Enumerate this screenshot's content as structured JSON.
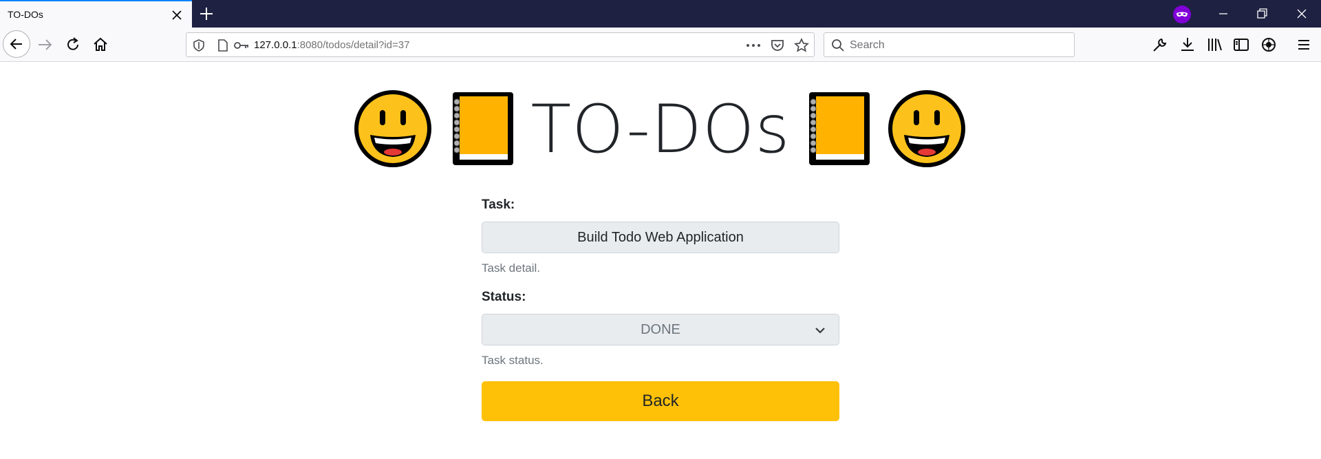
{
  "browser": {
    "tab_title": "TO-DOs",
    "url_host": "127.0.0.1",
    "url_rest": ":8080/todos/detail?id=37",
    "search_placeholder": "Search"
  },
  "page": {
    "title": "TO-DOs",
    "task_label": "Task:",
    "task_value": "Build Todo Web Application",
    "task_help": "Task detail.",
    "status_label": "Status:",
    "status_value": "DONE",
    "status_help": "Task status.",
    "back_label": "Back"
  },
  "icons": {
    "header_left": [
      "grinning-face-icon",
      "notebook-icon"
    ],
    "header_right": [
      "notebook-icon",
      "grinning-face-icon"
    ]
  },
  "colors": {
    "accent_button": "#ffc107",
    "tab_strip": "#1f2142",
    "active_tab_line": "#0a84ff",
    "private_badge": "#8000d7"
  }
}
